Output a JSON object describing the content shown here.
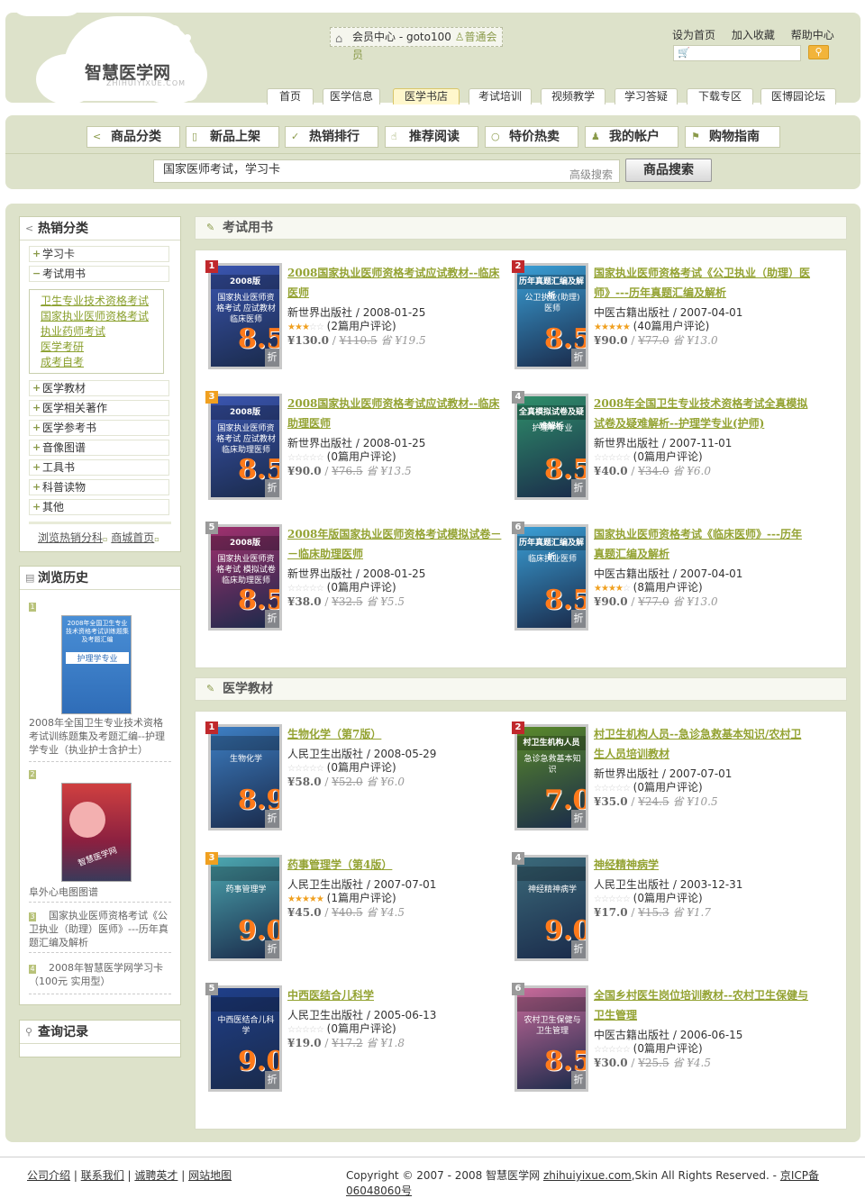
{
  "header": {
    "logo_text": "智慧医学网",
    "logo_sub": "ZHIHUIYIXUE.COM",
    "member_center": "会员中心 - goto100",
    "member_level": "普通会员",
    "top_links": [
      "设为首页",
      "加入收藏",
      "帮助中心"
    ],
    "nav": [
      "首页",
      "医学信息",
      "医学书店",
      "考试培训",
      "视频教学",
      "学习答疑",
      "下载专区",
      "医博园论坛"
    ],
    "nav_active": "医学书店"
  },
  "shop_tabs": [
    "商品分类",
    "新品上架",
    "热销排行",
    "推荐阅读",
    "特价热卖",
    "我的帐户",
    "购物指南"
  ],
  "shop_search": {
    "value": "国家医师考试，学习卡",
    "advanced": "高级搜索",
    "button": "商品搜索"
  },
  "sidebar": {
    "hot_title": "热销分类",
    "categories_top": [
      {
        "label": "学习卡",
        "sign": "+"
      },
      {
        "label": "考试用书",
        "sign": "−"
      }
    ],
    "subcategories": [
      "卫生专业技术资格考试",
      "国家执业医师资格考试",
      "执业药师考试",
      "医学考研",
      "成考自考"
    ],
    "categories_bottom": [
      "医学教材",
      "医学相关著作",
      "医学参考书",
      "音像图谱",
      "工具书",
      "科普读物",
      "其他"
    ],
    "links": [
      "浏览热销分科",
      "商城首页"
    ],
    "history_title": "浏览历史",
    "history": [
      {
        "num": "1",
        "text": "2008年全国卫生专业技术资格考试训练题集及考题汇编--护理学专业（执业护士含护士）",
        "cover_title": "2008年全国卫生专业技术资格考试训练题集及考题汇编",
        "cover_sub": "护理学专业"
      },
      {
        "num": "2",
        "text": "阜外心电图图谱",
        "cover_title": "智慧医学网",
        "cover_sub": "阜外心电图图谱"
      },
      {
        "num": "3",
        "text": "国家执业医师资格考试《公卫执业（助理）医师》---历年真题汇编及解析"
      },
      {
        "num": "4",
        "text": "2008年智慧医学网学习卡（100元 实用型）"
      }
    ],
    "query_title": "查询记录"
  },
  "sections": [
    {
      "title": "考试用书",
      "products": [
        {
          "rank": "1",
          "title": "2008国家执业医师资格考试应试教材--临床医师",
          "publisher": "新世界出版社",
          "date": "2008-01-25",
          "stars": 3,
          "reviews": "(2篇用户评论)",
          "price": "¥130.0",
          "old_price": "¥110.5",
          "save": "省 ¥19.5",
          "discount": "8.5",
          "cover_band": "2008版",
          "cover_title": "国家执业医师资格考试 应试教材 临床医师",
          "cover_color": "#3a55b0"
        },
        {
          "rank": "2",
          "title": "国家执业医师资格考试《公卫执业（助理）医师》---历年真题汇编及解析",
          "publisher": "中医古籍出版社",
          "date": "2007-04-01",
          "stars": 5,
          "reviews": "(40篇用户评论)",
          "price": "¥90.0",
          "old_price": "¥77.0",
          "save": "省 ¥13.0",
          "discount": "8.5",
          "cover_band": "历年真题汇编及解析",
          "cover_title": "公卫执业(助理)医师",
          "cover_color": "#3a9fd6"
        },
        {
          "rank": "3",
          "title": "2008国家执业医师资格考试应试教材--临床助理医师",
          "publisher": "新世界出版社",
          "date": "2008-01-25",
          "stars": 0,
          "reviews": "(0篇用户评论)",
          "price": "¥90.0",
          "old_price": "¥76.5",
          "save": "省 ¥13.5",
          "discount": "8.5",
          "cover_band": "2008版",
          "cover_title": "国家执业医师资格考试 应试教材 临床助理医师",
          "cover_color": "#3a55b0"
        },
        {
          "rank": "4",
          "title": "2008年全国卫生专业技术资格考试全真模拟试卷及疑难解析--护理学专业(护师)",
          "publisher": "新世界出版社",
          "date": "2007-11-01",
          "stars": 0,
          "reviews": "(0篇用户评论)",
          "price": "¥40.0",
          "old_price": "¥34.0",
          "save": "省 ¥6.0",
          "discount": "8.5",
          "cover_band": "全真模拟试卷及疑难解析",
          "cover_title": "护理学专业",
          "cover_color": "#2f8f6a"
        },
        {
          "rank": "5",
          "title": "2008年版国家执业医师资格考试模拟试卷－－临床助理医师",
          "publisher": "新世界出版社",
          "date": "2008-01-25",
          "stars": 0,
          "reviews": "(0篇用户评论)",
          "price": "¥38.0",
          "old_price": "¥32.5",
          "save": "省 ¥5.5",
          "discount": "8.5",
          "cover_band": "2008版",
          "cover_title": "国家执业医师资格考试 模拟试卷 临床助理医师",
          "cover_color": "#a0306e"
        },
        {
          "rank": "6",
          "title": "国家执业医师资格考试《临床医师》---历年真题汇编及解析",
          "publisher": "中医古籍出版社",
          "date": "2007-04-01",
          "stars": 4,
          "reviews": "(8篇用户评论)",
          "price": "¥90.0",
          "old_price": "¥77.0",
          "save": "省 ¥13.0",
          "discount": "8.5",
          "cover_band": "历年真题汇编及解析",
          "cover_title": "临床执业医师",
          "cover_color": "#3a9fd6"
        }
      ]
    },
    {
      "title": "医学教材",
      "products": [
        {
          "rank": "1",
          "title": "生物化学（第7版）",
          "publisher": "人民卫生出版社",
          "date": "2008-05-29",
          "stars": 0,
          "reviews": "(0篇用户评论)",
          "price": "¥58.0",
          "old_price": "¥52.0",
          "save": "省 ¥6.0",
          "discount": "8.9",
          "cover_band": "",
          "cover_title": "生物化学",
          "cover_color": "#3d7fc4"
        },
        {
          "rank": "2",
          "title": "村卫生机构人员--急诊急救基本知识/农村卫生人员培训教材",
          "publisher": "新世界出版社",
          "date": "2007-07-01",
          "stars": 0,
          "reviews": "(0篇用户评论)",
          "price": "¥35.0",
          "old_price": "¥24.5",
          "save": "省 ¥10.5",
          "discount": "7.0",
          "cover_band": "村卫生机构人员",
          "cover_title": "急诊急救基本知识",
          "cover_color": "#5a8a2a"
        },
        {
          "rank": "3",
          "title": "药事管理学（第4版）",
          "publisher": "人民卫生出版社",
          "date": "2007-07-01",
          "stars": 5,
          "reviews": "(1篇用户评论)",
          "price": "¥45.0",
          "old_price": "¥40.5",
          "save": "省 ¥4.5",
          "discount": "9.0",
          "cover_band": "",
          "cover_title": "药事管理学",
          "cover_color": "#4ca7b0"
        },
        {
          "rank": "4",
          "title": "神经精神病学",
          "publisher": "人民卫生出版社",
          "date": "2003-12-31",
          "stars": 0,
          "reviews": "(0篇用户评论)",
          "price": "¥17.0",
          "old_price": "¥15.3",
          "save": "省 ¥1.7",
          "discount": "9.0",
          "cover_band": "",
          "cover_title": "神经精神病学",
          "cover_color": "#3b6a7a"
        },
        {
          "rank": "5",
          "title": "中西医结合儿科学",
          "publisher": "人民卫生出版社",
          "date": "2005-06-13",
          "stars": 0,
          "reviews": "(0篇用户评论)",
          "price": "¥19.0",
          "old_price": "¥17.2",
          "save": "省 ¥1.8",
          "discount": "9.0",
          "cover_band": "",
          "cover_title": "中西医结合儿科学",
          "cover_color": "#1f3f8a"
        },
        {
          "rank": "6",
          "title": "全国乡村医生岗位培训教材--农村卫生保健与卫生管理",
          "publisher": "中医古籍出版社",
          "date": "2006-06-15",
          "stars": 0,
          "reviews": "(0篇用户评论)",
          "price": "¥30.0",
          "old_price": "¥25.5",
          "save": "省 ¥4.5",
          "discount": "8.5",
          "cover_band": "",
          "cover_title": "农村卫生保健与卫生管理",
          "cover_color": "#c86a9a"
        }
      ]
    }
  ],
  "footer": {
    "links": [
      "公司介绍",
      "联系我们",
      "诚聘英才",
      "网站地图"
    ],
    "copyright_pre": "Copyright © 2007 - 2008 智慧医学网 ",
    "domain": "zhihuiyixue.com",
    "copyright_post": ",Skin All Rights Reserved. - ",
    "icp": "京ICP备06048060号"
  },
  "colors": {
    "accent_green": "#94a333",
    "header_bg": "#dde2ca",
    "price_orange": "#ff7a1a",
    "rank_red": "#c0282c",
    "rank_orange": "#f0a020",
    "rank_gray": "#9a9a9a"
  },
  "icons": [
    "home-icon",
    "search-icon",
    "category-icon",
    "pencil-icon",
    "arrow-icon"
  ]
}
